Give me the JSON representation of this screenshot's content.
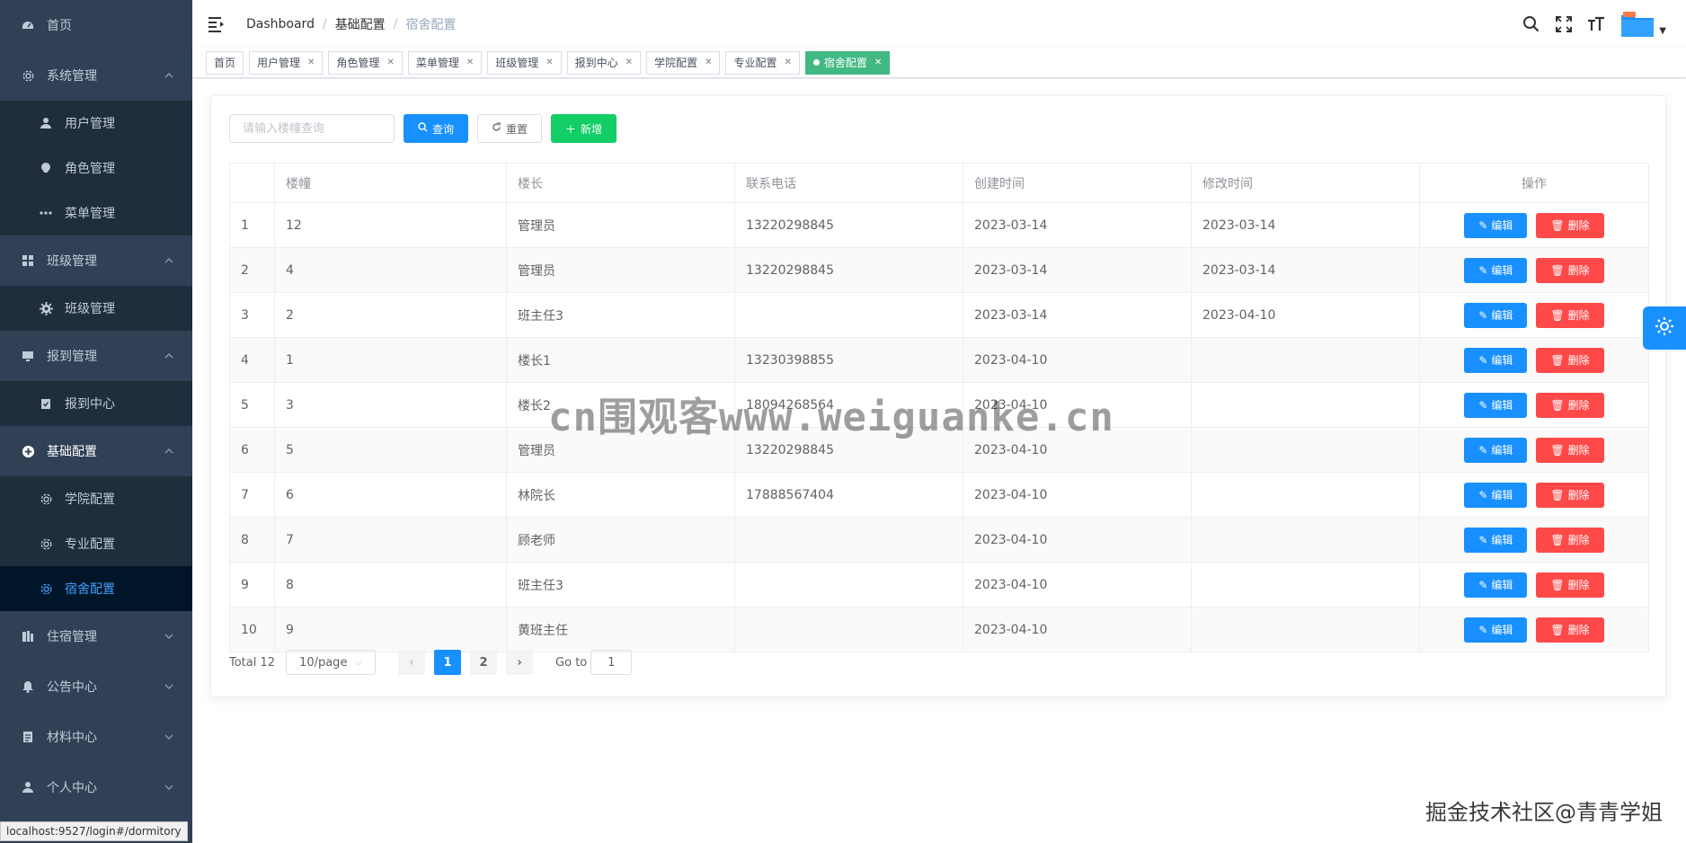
{
  "sidebar": {
    "items": [
      {
        "label": "首页",
        "icon": "dashboard-icon"
      },
      {
        "label": "系统管理",
        "icon": "gear-icon",
        "expanded": true,
        "children": [
          {
            "label": "用户管理",
            "icon": "user-icon"
          },
          {
            "label": "角色管理",
            "icon": "role-icon"
          },
          {
            "label": "菜单管理",
            "icon": "more-dots-icon"
          }
        ]
      },
      {
        "label": "班级管理",
        "icon": "grid-icon",
        "expanded": true,
        "children": [
          {
            "label": "班级管理",
            "icon": "cog-icon"
          }
        ]
      },
      {
        "label": "报到管理",
        "icon": "monitor-icon",
        "expanded": true,
        "children": [
          {
            "label": "报到中心",
            "icon": "clipboard-icon"
          }
        ]
      },
      {
        "label": "基础配置",
        "icon": "circle-plus-icon",
        "expanded": true,
        "children": [
          {
            "label": "学院配置",
            "icon": "gear-icon"
          },
          {
            "label": "专业配置",
            "icon": "gear-icon"
          },
          {
            "label": "宿舍配置",
            "icon": "gear-icon",
            "active": true
          }
        ]
      },
      {
        "label": "住宿管理",
        "icon": "building-icon"
      },
      {
        "label": "公告中心",
        "icon": "bell-icon"
      },
      {
        "label": "材料中心",
        "icon": "document-icon"
      },
      {
        "label": "个人中心",
        "icon": "user-icon"
      }
    ]
  },
  "header": {
    "breadcrumb": [
      "Dashboard",
      "基础配置",
      "宿舍配置"
    ]
  },
  "tags": [
    {
      "label": "首页",
      "closable": false
    },
    {
      "label": "用户管理",
      "closable": true
    },
    {
      "label": "角色管理",
      "closable": true
    },
    {
      "label": "菜单管理",
      "closable": true
    },
    {
      "label": "班级管理",
      "closable": true
    },
    {
      "label": "报到中心",
      "closable": true
    },
    {
      "label": "学院配置",
      "closable": true
    },
    {
      "label": "专业配置",
      "closable": true
    },
    {
      "label": "宿舍配置",
      "closable": true,
      "active": true
    }
  ],
  "toolbar": {
    "search_placeholder": "请输入楼幢查询",
    "query_label": "查询",
    "reset_label": "重置",
    "add_label": "新增"
  },
  "table": {
    "columns": [
      "",
      "楼幢",
      "楼长",
      "联系电话",
      "创建时间",
      "修改时间",
      "操作"
    ],
    "rows": [
      [
        "1",
        "12",
        "管理员",
        "13220298845",
        "2023-03-14",
        "2023-03-14"
      ],
      [
        "2",
        "4",
        "管理员",
        "13220298845",
        "2023-03-14",
        "2023-03-14"
      ],
      [
        "3",
        "2",
        "班主任3",
        "",
        "2023-03-14",
        "2023-04-10"
      ],
      [
        "4",
        "1",
        "楼长1",
        "13230398855",
        "2023-04-10",
        ""
      ],
      [
        "5",
        "3",
        "楼长2",
        "18094268564",
        "2023-04-10",
        ""
      ],
      [
        "6",
        "5",
        "管理员",
        "13220298845",
        "2023-04-10",
        ""
      ],
      [
        "7",
        "6",
        "林院长",
        "17888567404",
        "2023-04-10",
        ""
      ],
      [
        "8",
        "7",
        "顾老师",
        "",
        "2023-04-10",
        ""
      ],
      [
        "9",
        "8",
        "班主任3",
        "",
        "2023-04-10",
        ""
      ],
      [
        "10",
        "9",
        "黄班主任",
        "",
        "2023-04-10",
        ""
      ]
    ],
    "edit_label": "编辑",
    "delete_label": "删除"
  },
  "pagination": {
    "total": "Total 12",
    "page_size": "10/page",
    "pages": [
      "1",
      "2"
    ],
    "current": "1",
    "goto_label": "Go to",
    "goto_value": "1"
  },
  "overlay": {
    "watermark": "cn围观客www.weiguanke.cn",
    "corner": "掘金技术社区@青青学姐",
    "status_url": "localhost:9527/login#/dormitory"
  },
  "colors": {
    "sidebar_bg": "#304156",
    "submenu_bg": "#1f2d3d",
    "active_text": "#409eff",
    "primary": "#1890ff",
    "success": "#13ce66",
    "danger": "#ff4949",
    "tag_active": "#42b983"
  }
}
